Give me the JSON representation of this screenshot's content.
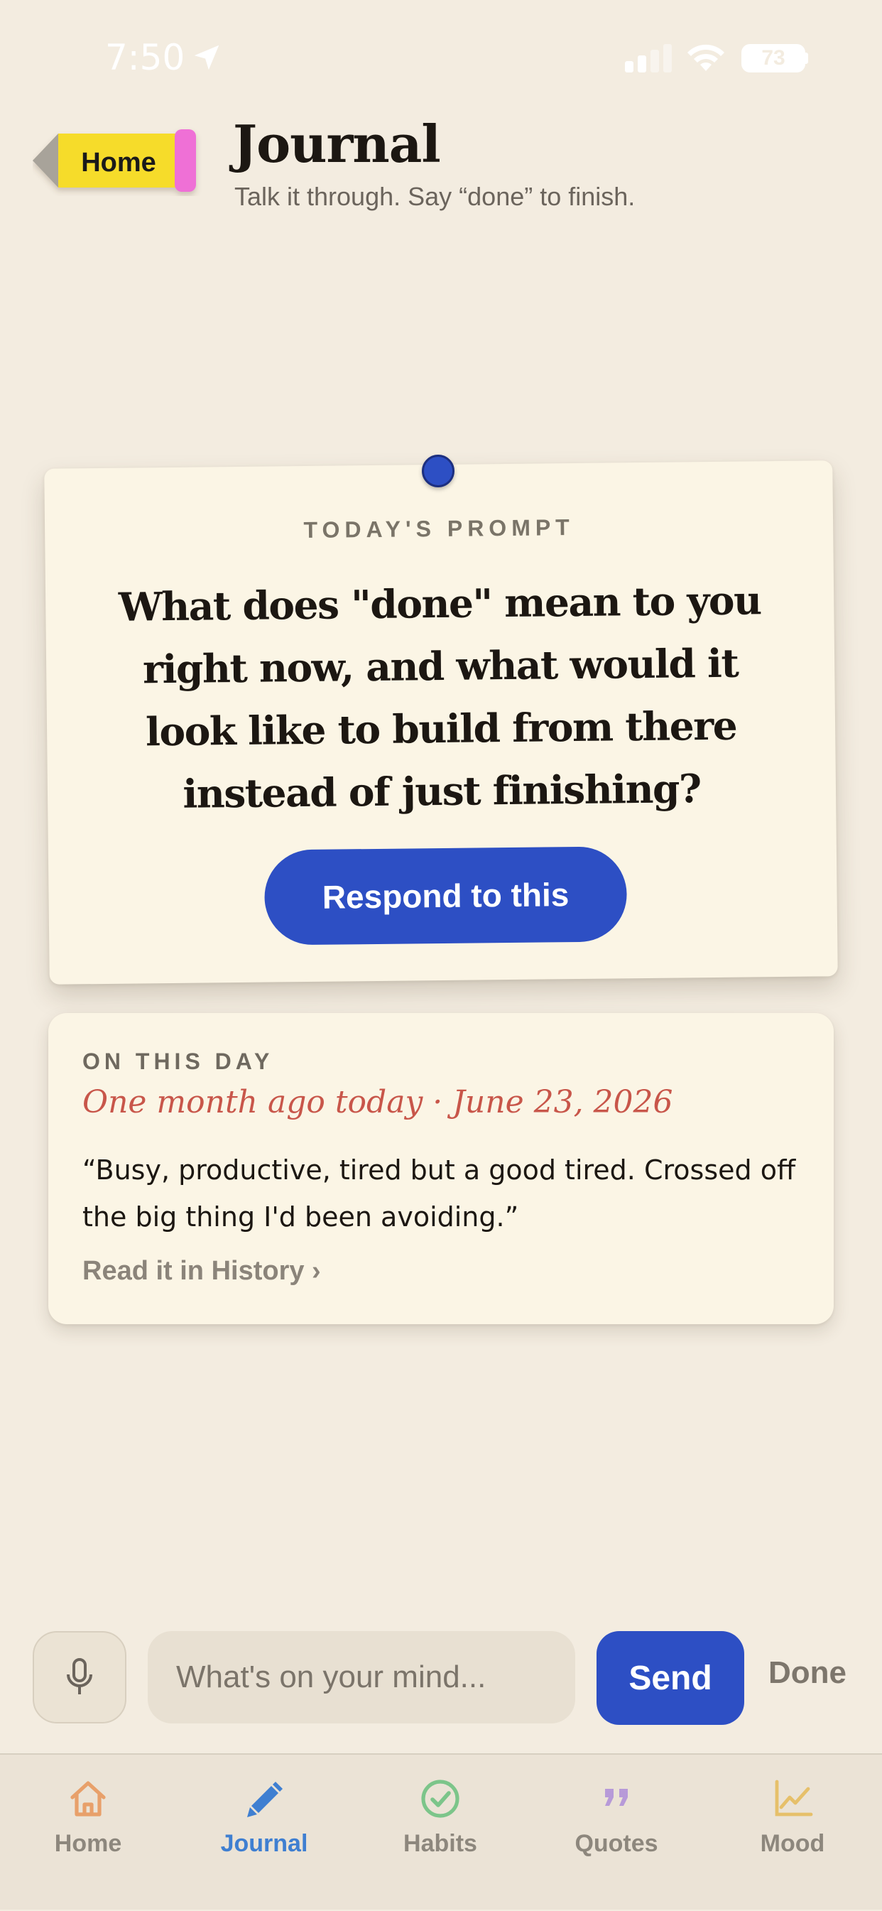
{
  "status_bar": {
    "time": "7:50",
    "battery": "73"
  },
  "header": {
    "home_button": "Home",
    "title": "Journal",
    "subtitle": "Talk it through. Say “done” to finish."
  },
  "prompt_card": {
    "label": "TODAY'S PROMPT",
    "question": "What does \"done\" mean to you right now, and what would it look like to build from there instead of just finishing?",
    "button": "Respond to this"
  },
  "on_this_day": {
    "label": "ON THIS DAY",
    "date_line": "One month ago today · June 23, 2026",
    "quote": "“Busy, productive, tired but a good tired. Crossed off the big thing I'd been avoiding.”",
    "link": "Read it in History ›"
  },
  "composer": {
    "mic_icon": "microphone-icon",
    "placeholder": "What's on your mind...",
    "value": "",
    "send": "Send",
    "done": "Done"
  },
  "tabs": [
    {
      "label": "Home",
      "icon": "house-icon",
      "color": "#e8a06a",
      "active": false
    },
    {
      "label": "Journal",
      "icon": "pencil-icon",
      "color": "#3f7fd1",
      "active": true
    },
    {
      "label": "Habits",
      "icon": "check-circle-icon",
      "color": "#7cc58a",
      "active": false
    },
    {
      "label": "Quotes",
      "icon": "quote-icon",
      "color": "#b79ad8",
      "active": false
    },
    {
      "label": "Mood",
      "icon": "chart-line-icon",
      "color": "#e6c06a",
      "active": false
    }
  ],
  "colors": {
    "background": "#f3ece0",
    "card": "#fbf5e5",
    "accent": "#2d4fc4",
    "date_accent": "#c8564a"
  }
}
